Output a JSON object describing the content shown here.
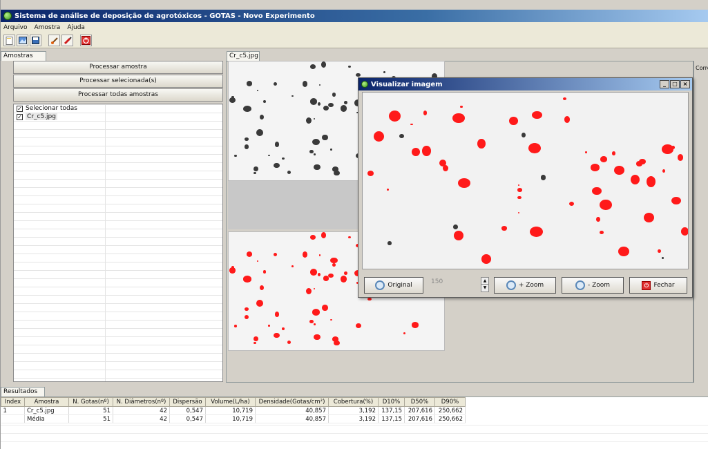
{
  "window": {
    "title": "Sistema de análise de deposição de agrotóxicos - GOTAS - Novo Experimento"
  },
  "menu": [
    "Arquivo",
    "Amostra",
    "Ajuda"
  ],
  "toolbar": {
    "icons": [
      "new-file-icon",
      "open-image-icon",
      "save-icon",
      "paint-icon",
      "marker-icon",
      "power-icon"
    ]
  },
  "left": {
    "tab": "Amostras",
    "buttons": {
      "process": "Processar amostra",
      "process_selected": "Processar selecionada(s)",
      "process_all": "Processar todas amostras"
    },
    "select_all": "Selecionar todas",
    "samples": [
      "Cr_c5.jpg"
    ]
  },
  "image_tab": "Cr_c5.jpg",
  "right_cut": "Corre",
  "modal": {
    "title": "Visualizar imagem",
    "original": "Original",
    "zoom_value": "150",
    "zoom_in": "+ Zoom",
    "zoom_out": "- Zoom",
    "close": "Fechar"
  },
  "results": {
    "tab": "Resultados",
    "headers": [
      "Index",
      "Amostra",
      "N. Gotas(nº)",
      "N. Diâmetros(nº)",
      "Dispersão",
      "Volume(L/ha)",
      "Densidade(Gotas/cm²)",
      "Cobertura(%)",
      "D10%",
      "D50%",
      "D90%"
    ],
    "rows": [
      [
        "1",
        "Cr_c5.jpg",
        "51",
        "42",
        "0,547",
        "10,719",
        "40,857",
        "3,192",
        "137,15",
        "207,616",
        "250,662"
      ],
      [
        "",
        "Média",
        "51",
        "42",
        "0,547",
        "10,719",
        "40,857",
        "3,192",
        "137,15",
        "207,616",
        "250,662"
      ]
    ]
  },
  "colors": {
    "droplet_marked": "#ff1a1a",
    "droplet_raw": "#3a3a3a",
    "titlebar": "#0a246a"
  }
}
